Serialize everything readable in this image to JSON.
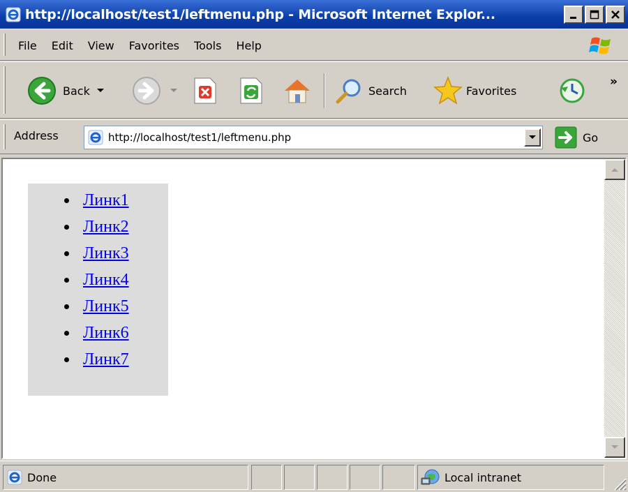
{
  "window": {
    "title": "http://localhost/test1/leftmenu.php - Microsoft Internet Explor...",
    "buttons": [
      "minimize",
      "maximize",
      "close"
    ]
  },
  "menubar": {
    "items": [
      "File",
      "Edit",
      "View",
      "Favorites",
      "Tools",
      "Help"
    ]
  },
  "toolbar": {
    "back_label": "Back",
    "search_label": "Search",
    "favorites_label": "Favorites",
    "more_chevron": "»"
  },
  "address": {
    "label": "Address",
    "url": "http://localhost/test1/leftmenu.php",
    "go_label": "Go"
  },
  "page": {
    "links": [
      "Линк1",
      "Линк2",
      "Линк3",
      "Линк4",
      "Линк5",
      "Линк6",
      "Линк7"
    ]
  },
  "status": {
    "text": "Done",
    "zone": "Local intranet"
  },
  "colors": {
    "titlebar": "#0a3fa8",
    "chrome": "#d4d0c8",
    "link": "#0000ee",
    "menu_box_bg": "#dcdcdc"
  }
}
